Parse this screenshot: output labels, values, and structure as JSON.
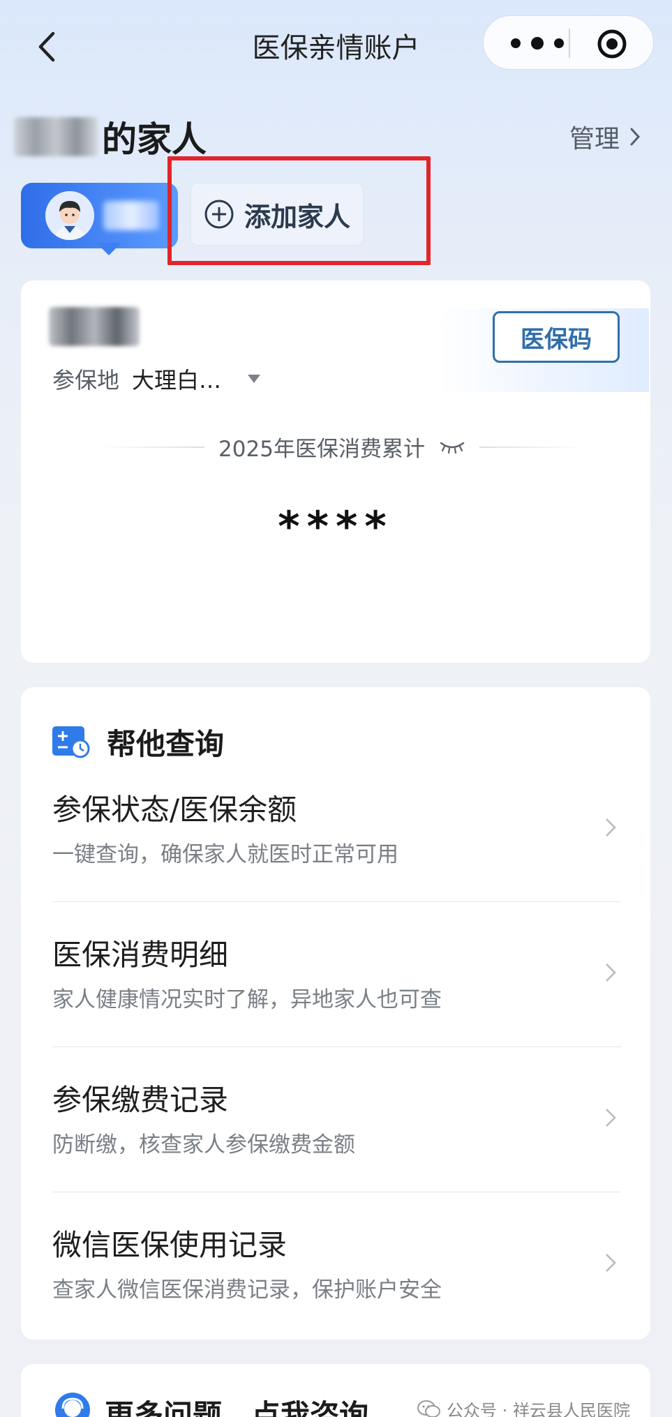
{
  "header": {
    "title": "医保亲情账户"
  },
  "family": {
    "title_suffix": "的家人",
    "manage_label": "管理",
    "add_family_label": "添加家人"
  },
  "account_card": {
    "qr_button_label": "医保码",
    "location_label": "参保地",
    "location_value": "大理白…",
    "spend_label": "2025年医保消费累计",
    "masked_value": "****"
  },
  "help_section": {
    "title": "帮他查询",
    "items": [
      {
        "title": "参保状态/医保余额",
        "subtitle": "一键查询，确保家人就医时正常可用"
      },
      {
        "title": "医保消费明细",
        "subtitle": "家人健康情况实时了解，异地家人也可查"
      },
      {
        "title": "参保缴费记录",
        "subtitle": "防断缴，核查家人参保缴费金额"
      },
      {
        "title": "微信医保使用记录",
        "subtitle": "查家人微信医保消费记录，保护账户安全"
      }
    ]
  },
  "consult": {
    "label": "更多问题，点我咨询"
  },
  "watermark": {
    "text": "公众号 · 祥云县人民医院"
  },
  "colors": {
    "accent_blue": "#2f6ea8",
    "chip_blue": "#2f6ee8",
    "highlight_red": "#e0252b"
  }
}
